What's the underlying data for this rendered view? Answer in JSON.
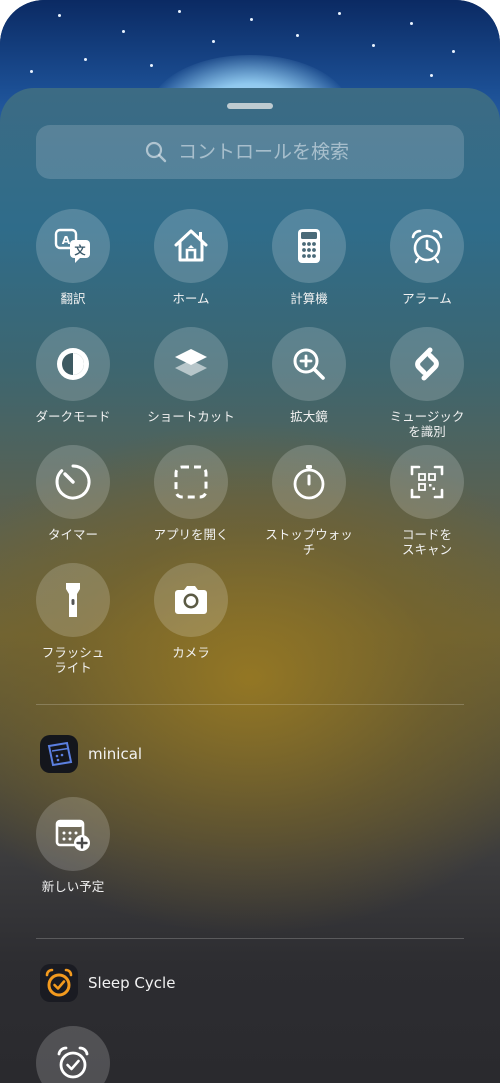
{
  "search": {
    "placeholder": "コントロールを検索"
  },
  "controls": [
    {
      "label": "翻訳",
      "icon": "translate-icon"
    },
    {
      "label": "ホーム",
      "icon": "home-icon"
    },
    {
      "label": "計算機",
      "icon": "calculator-icon"
    },
    {
      "label": "アラーム",
      "icon": "alarm-icon"
    },
    {
      "label": "ダークモード",
      "icon": "dark-mode-icon"
    },
    {
      "label": "ショートカット",
      "icon": "shortcuts-icon"
    },
    {
      "label": "拡大鏡",
      "icon": "magnifier-icon"
    },
    {
      "label": "ミュージック\nを識別",
      "icon": "shazam-icon"
    },
    {
      "label": "タイマー",
      "icon": "timer-icon"
    },
    {
      "label": "アプリを開く",
      "icon": "open-app-icon"
    },
    {
      "label": "ストップウォッ\nチ",
      "icon": "stopwatch-icon"
    },
    {
      "label": "コードを\nスキャン",
      "icon": "qr-scan-icon"
    },
    {
      "label": "フラッシュ\nライト",
      "icon": "flashlight-icon"
    },
    {
      "label": "カメラ",
      "icon": "camera-icon"
    }
  ],
  "apps": [
    {
      "name": "minical",
      "icon": "minical-app-icon",
      "controls": [
        {
          "label": "新しい予定",
          "icon": "new-event-icon"
        }
      ]
    },
    {
      "name": "Sleep Cycle",
      "icon": "sleep-cycle-app-icon",
      "controls": [
        {
          "label": "",
          "icon": "sleep-alarm-icon"
        }
      ]
    }
  ],
  "colors": {
    "sleep_cycle_accent": "#f39a1e",
    "minical_accent": "#5b7fe0"
  }
}
